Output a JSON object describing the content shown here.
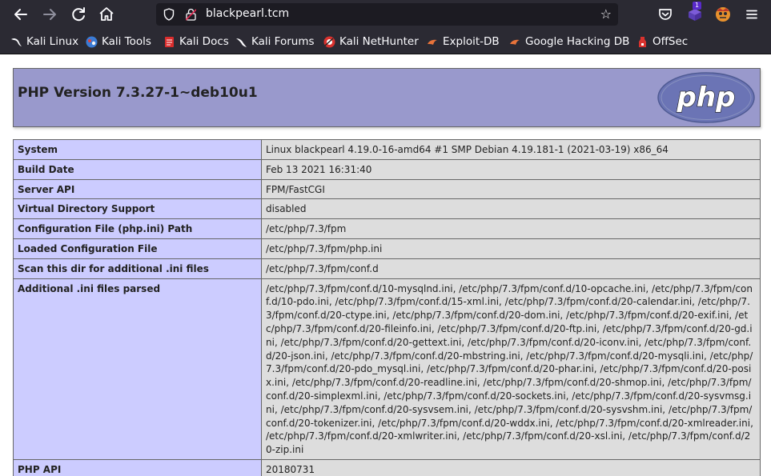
{
  "browser": {
    "url": "blackpearl.tcm",
    "notification_badge": "1",
    "bookmarks": [
      {
        "label": "Kali Linux",
        "icon": "kali-dragon-icon"
      },
      {
        "label": "Kali Tools",
        "icon": "kali-tools-icon"
      },
      {
        "label": "Kali Docs",
        "icon": "kali-docs-icon"
      },
      {
        "label": "Kali Forums",
        "icon": "kali-forums-icon"
      },
      {
        "label": "Kali NetHunter",
        "icon": "nethunter-icon"
      },
      {
        "label": "Exploit-DB",
        "icon": "exploit-db-icon"
      },
      {
        "label": "Google Hacking DB",
        "icon": "ghdb-icon"
      },
      {
        "label": "OffSec",
        "icon": "offsec-icon"
      }
    ]
  },
  "phpinfo": {
    "title": "PHP Version 7.3.27-1~deb10u1",
    "logo_text": "php",
    "rows": [
      {
        "key": "System",
        "value": "Linux blackpearl 4.19.0-16-amd64 #1 SMP Debian 4.19.181-1 (2021-03-19) x86_64"
      },
      {
        "key": "Build Date",
        "value": "Feb 13 2021 16:31:40"
      },
      {
        "key": "Server API",
        "value": "FPM/FastCGI"
      },
      {
        "key": "Virtual Directory Support",
        "value": "disabled"
      },
      {
        "key": "Configuration File (php.ini) Path",
        "value": "/etc/php/7.3/fpm"
      },
      {
        "key": "Loaded Configuration File",
        "value": "/etc/php/7.3/fpm/php.ini"
      },
      {
        "key": "Scan this dir for additional .ini files",
        "value": "/etc/php/7.3/fpm/conf.d"
      },
      {
        "key": "Additional .ini files parsed",
        "value": "/etc/php/7.3/fpm/conf.d/10-mysqlnd.ini, /etc/php/7.3/fpm/conf.d/10-opcache.ini, /etc/php/7.3/fpm/conf.d/10-pdo.ini, /etc/php/7.3/fpm/conf.d/15-xml.ini, /etc/php/7.3/fpm/conf.d/20-calendar.ini, /etc/php/7.3/fpm/conf.d/20-ctype.ini, /etc/php/7.3/fpm/conf.d/20-dom.ini, /etc/php/7.3/fpm/conf.d/20-exif.ini, /etc/php/7.3/fpm/conf.d/20-fileinfo.ini, /etc/php/7.3/fpm/conf.d/20-ftp.ini, /etc/php/7.3/fpm/conf.d/20-gd.ini, /etc/php/7.3/fpm/conf.d/20-gettext.ini, /etc/php/7.3/fpm/conf.d/20-iconv.ini, /etc/php/7.3/fpm/conf.d/20-json.ini, /etc/php/7.3/fpm/conf.d/20-mbstring.ini, /etc/php/7.3/fpm/conf.d/20-mysqli.ini, /etc/php/7.3/fpm/conf.d/20-pdo_mysql.ini, /etc/php/7.3/fpm/conf.d/20-phar.ini, /etc/php/7.3/fpm/conf.d/20-posix.ini, /etc/php/7.3/fpm/conf.d/20-readline.ini, /etc/php/7.3/fpm/conf.d/20-shmop.ini, /etc/php/7.3/fpm/conf.d/20-simplexml.ini, /etc/php/7.3/fpm/conf.d/20-sockets.ini, /etc/php/7.3/fpm/conf.d/20-sysvmsg.ini, /etc/php/7.3/fpm/conf.d/20-sysvsem.ini, /etc/php/7.3/fpm/conf.d/20-sysvshm.ini, /etc/php/7.3/fpm/conf.d/20-tokenizer.ini, /etc/php/7.3/fpm/conf.d/20-wddx.ini, /etc/php/7.3/fpm/conf.d/20-xmlreader.ini, /etc/php/7.3/fpm/conf.d/20-xmlwriter.ini, /etc/php/7.3/fpm/conf.d/20-xsl.ini, /etc/php/7.3/fpm/conf.d/20-zip.ini"
      },
      {
        "key": "PHP API",
        "value": "20180731"
      }
    ]
  },
  "colors": {
    "chrome_bg": "#2b2a33",
    "urlbar_bg": "#1c1b22",
    "header_bg": "#9999cc",
    "key_cell_bg": "#ccccff",
    "value_cell_bg": "#dddddd"
  }
}
